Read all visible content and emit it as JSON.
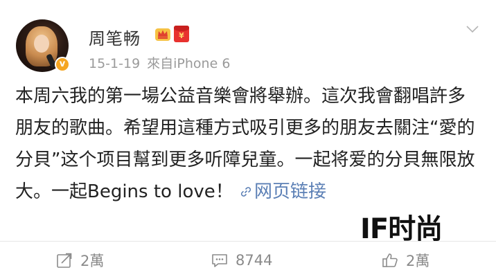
{
  "header": {
    "username": "周笔畅",
    "verified_mark": "v",
    "date": "15-1-19",
    "source": "來自iPhone 6",
    "badges": [
      "crown-icon",
      "red-packet-icon"
    ],
    "redpacket_symbol": "¥"
  },
  "content": {
    "text": "本周六我的第一場公益音樂會將舉辦。這次我會翻唱許多朋友的歌曲。希望用這種方式吸引更多的朋友去關注“愛的分貝”这个项目幫到更多听障兒童。一起将爱的分貝無限放大。一起Begins to love！",
    "link_label": "网页链接"
  },
  "watermark": "IF时尚",
  "actions": {
    "repost_count": "2萬",
    "comment_count": "8744",
    "like_count": "2萬"
  },
  "colors": {
    "link": "#5b7fb5",
    "text": "#222222",
    "meta": "#9a9a9a",
    "verified": "#f5a623",
    "redpacket": "#e8322f"
  }
}
